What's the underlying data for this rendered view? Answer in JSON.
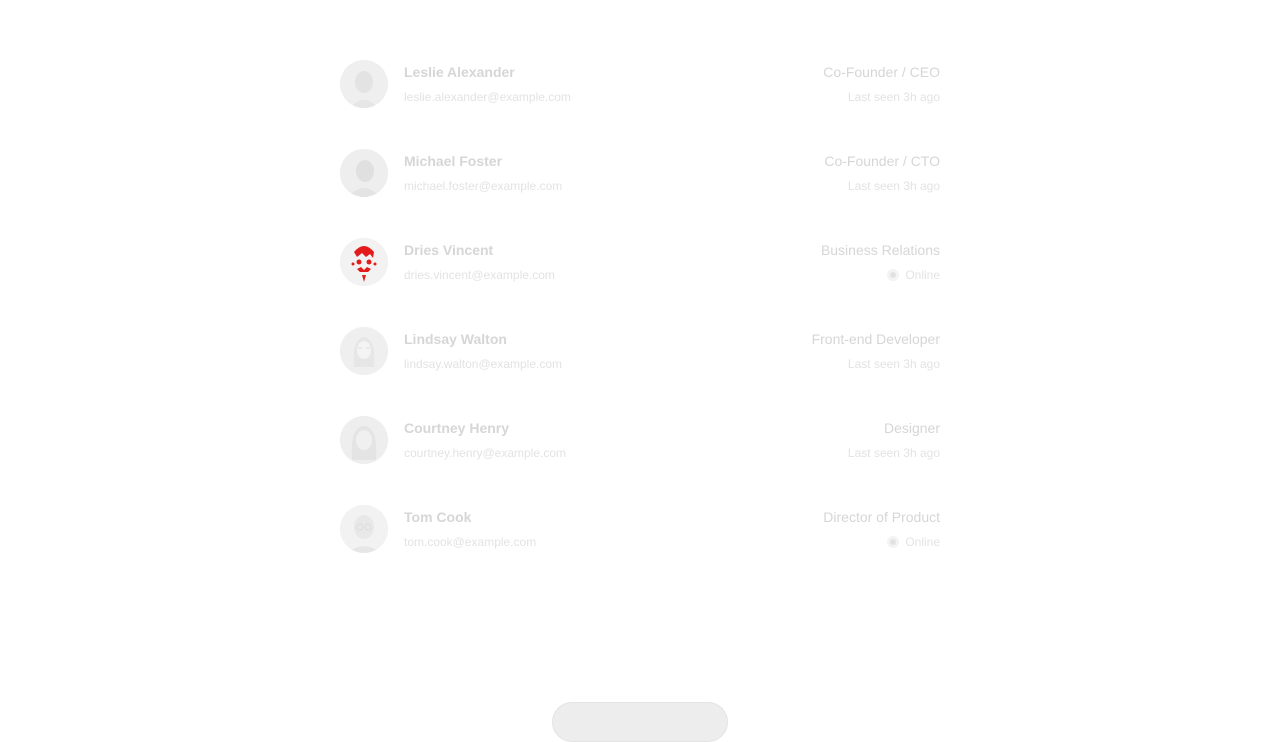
{
  "people": [
    {
      "name": "Leslie Alexander",
      "email": "leslie.alexander@example.com",
      "role": "Co-Founder / CEO",
      "status": "Last seen 3h ago",
      "online": false,
      "avatar_tint": "#dcdcdc"
    },
    {
      "name": "Michael Foster",
      "email": "michael.foster@example.com",
      "role": "Co-Founder / CTO",
      "status": "Last seen 3h ago",
      "online": false,
      "avatar_tint": "#d8d8d8"
    },
    {
      "name": "Dries Vincent",
      "email": "dries.vincent@example.com",
      "role": "Business Relations",
      "status": "Online",
      "online": true,
      "avatar_tint": "#e41b1b"
    },
    {
      "name": "Lindsay Walton",
      "email": "lindsay.walton@example.com",
      "role": "Front-end Developer",
      "status": "Last seen 3h ago",
      "online": false,
      "avatar_tint": "#dadada"
    },
    {
      "name": "Courtney Henry",
      "email": "courtney.henry@example.com",
      "role": "Designer",
      "status": "Last seen 3h ago",
      "online": false,
      "avatar_tint": "#dcdcdc"
    },
    {
      "name": "Tom Cook",
      "email": "tom.cook@example.com",
      "role": "Director of Product",
      "status": "Online",
      "online": true,
      "avatar_tint": "#e0e0e0"
    }
  ]
}
